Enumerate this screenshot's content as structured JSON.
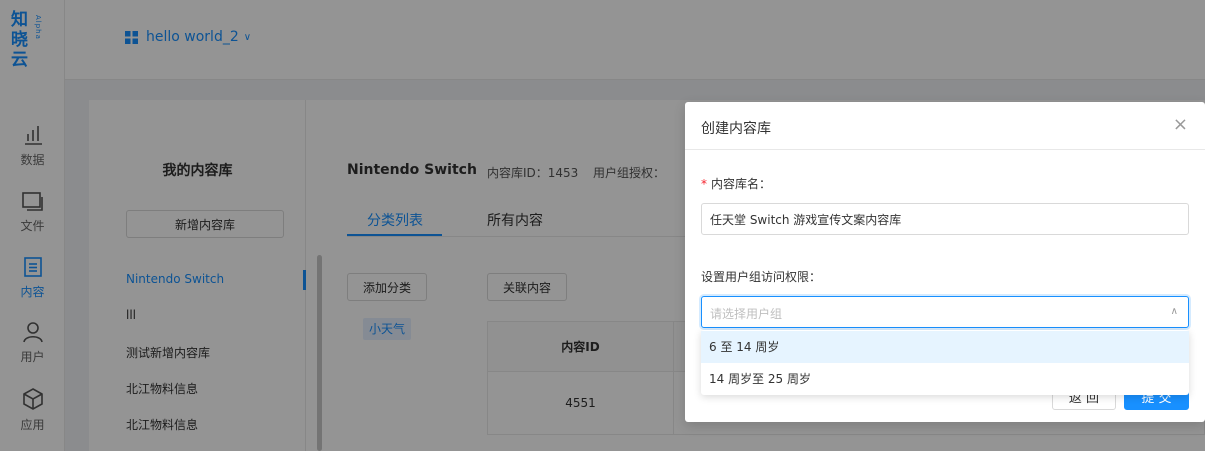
{
  "logo": {
    "text": "知晓云",
    "badge": "Alpha"
  },
  "nav": [
    {
      "label": "数据",
      "icon": "bar-chart-icon"
    },
    {
      "label": "文件",
      "icon": "folder-icon"
    },
    {
      "label": "内容",
      "icon": "document-icon",
      "active": true
    },
    {
      "label": "用户",
      "icon": "user-icon"
    },
    {
      "label": "应用",
      "icon": "cube-icon"
    }
  ],
  "header": {
    "project_name": "hello world_2",
    "chevron": "∨"
  },
  "library": {
    "title": "我的内容库",
    "add_button": "新增内容库",
    "items": [
      "Nintendo Switch",
      "lll",
      "测试新增内容库",
      "北江物料信息",
      "北江物料信息"
    ]
  },
  "content": {
    "title": "Nintendo Switch",
    "library_id": "内容库ID：1453",
    "user_group": "用户组授权：",
    "tabs": [
      "分类列表",
      "所有内容"
    ],
    "add_category": "添加分类",
    "link_content": "关联内容",
    "tag": "小天气",
    "table": {
      "header_id": "内容ID",
      "row_id": "4551"
    }
  },
  "modal": {
    "title": "创建内容库",
    "close": "×",
    "name_label": "内容库名：",
    "required_mark": "*",
    "name_value": "任天堂 Switch 游戏宣传文案内容库",
    "access_label": "设置用户组访问权限：",
    "select_placeholder": "请选择用户组",
    "back_button": "返 回",
    "submit_button": "提 交"
  },
  "dropdown": {
    "options": [
      "6 至 14 周岁",
      "14 周岁至 25 周岁"
    ]
  },
  "colors": {
    "accent": "#1890ff",
    "required": "#f5222d"
  }
}
